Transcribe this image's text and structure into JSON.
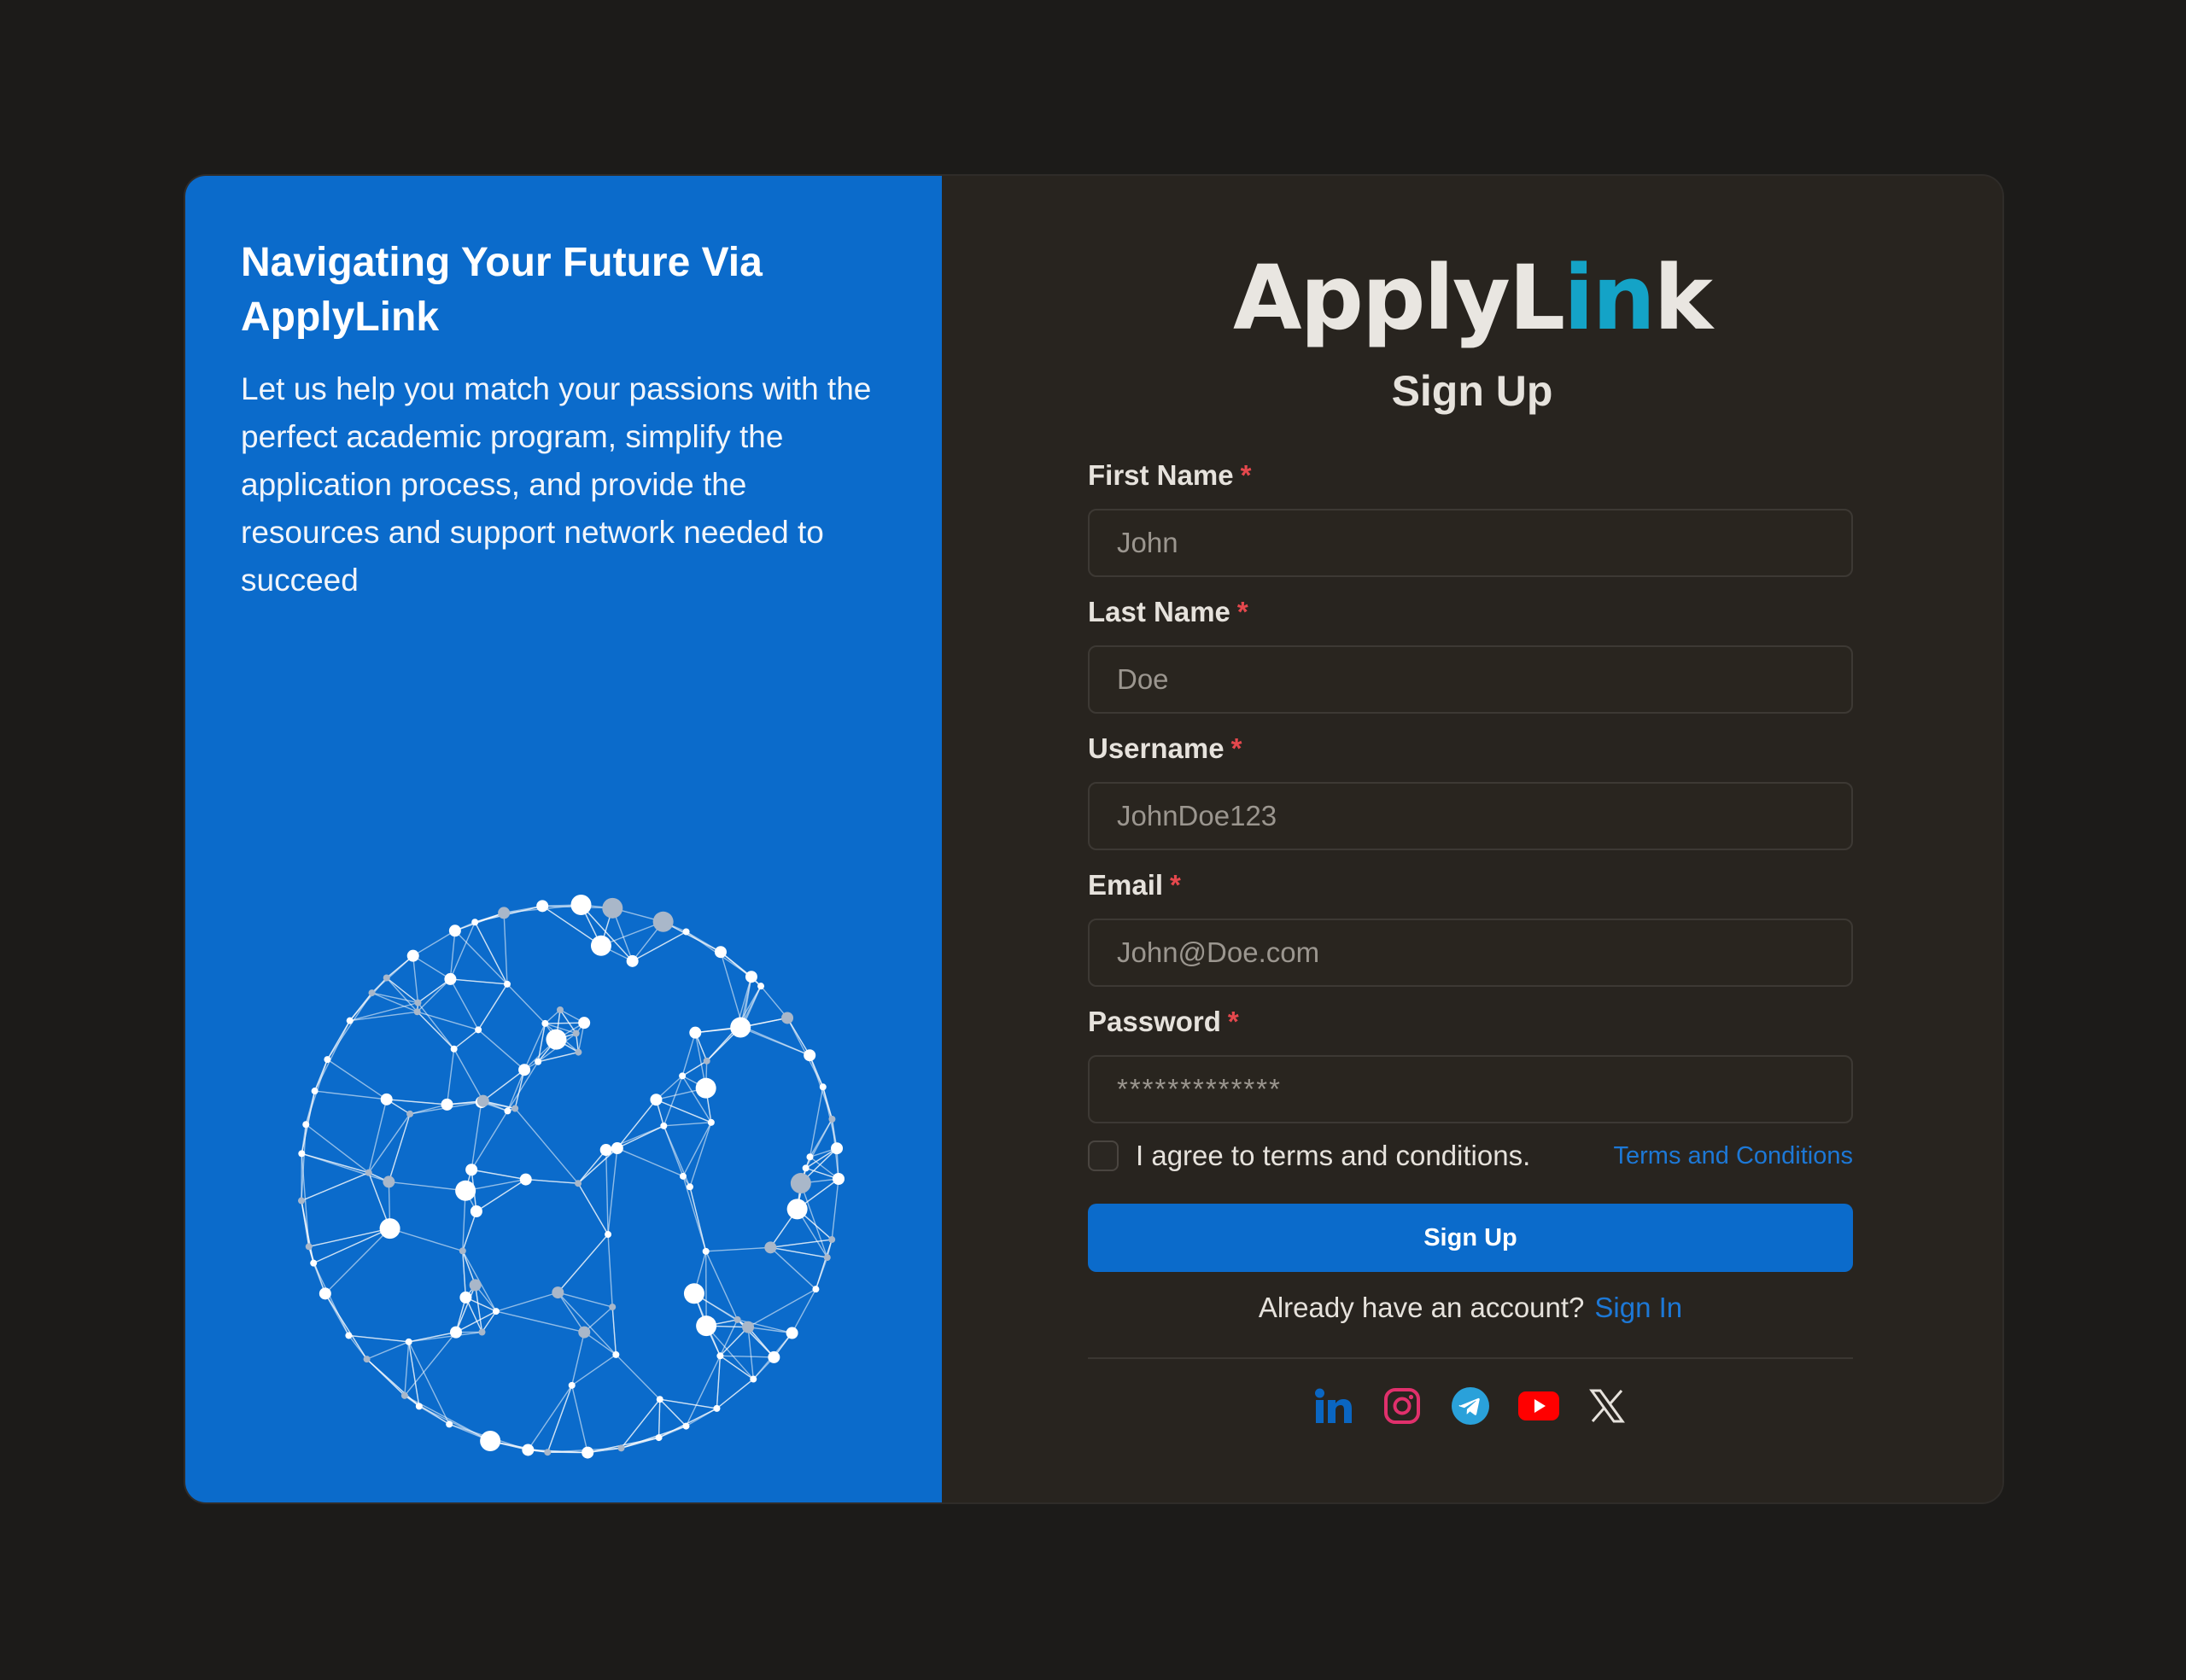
{
  "hero": {
    "title": "Navigating Your Future Via ApplyLink",
    "description": "Let us help you match your passions with the perfect academic program, simplify the application process, and provide the resources and support network needed to succeed"
  },
  "brand": {
    "logo_prefix": "ApplyL",
    "logo_accent": "in",
    "logo_suffix": "k"
  },
  "form": {
    "title": "Sign Up",
    "required_marker": "*",
    "fields": [
      {
        "label": "First Name",
        "placeholder": "John"
      },
      {
        "label": "Last Name",
        "placeholder": "Doe"
      },
      {
        "label": "Username",
        "placeholder": "JohnDoe123"
      },
      {
        "label": "Email",
        "placeholder": "John@Doe.com"
      },
      {
        "label": "Password",
        "placeholder": "*************"
      }
    ],
    "agree_text": "I agree to terms and conditions.",
    "terms_link": "Terms and Conditions",
    "submit_label": "Sign Up",
    "signin_prompt": "Already have an account?",
    "signin_link": "Sign In"
  },
  "social": [
    "linkedin-icon",
    "instagram-icon",
    "telegram-icon",
    "youtube-icon",
    "x-icon"
  ],
  "colors": {
    "page_bg": "#1c1b19",
    "panel_blue": "#0b6bcb",
    "card_bg": "#28241f",
    "link": "#1d78d6",
    "required": "#e5484d"
  }
}
